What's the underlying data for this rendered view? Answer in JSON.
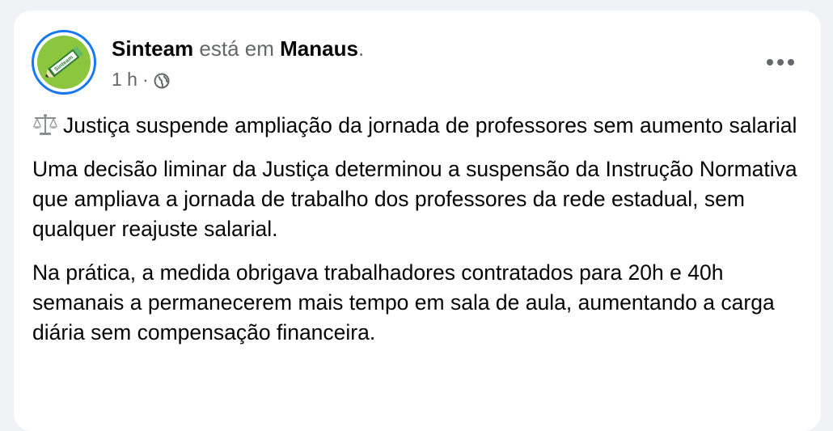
{
  "post": {
    "author": "Sinteam",
    "action": "está em",
    "place": "Manaus",
    "place_suffix": ".",
    "time": "1 h",
    "separator": "·",
    "privacy_icon": "globe-icon",
    "menu_icon": "more-horizontal-icon",
    "avatar_icon": "pencil-logo-icon",
    "avatar_logo_text": "Sinteam",
    "headline_emoji": "balance-scale-icon",
    "headline": "Justiça suspende ampliação da jornada de professores sem aumento salarial",
    "paragraphs": [
      "Uma decisão liminar da Justiça determinou a suspensão da Instrução Normativa que ampliava a jornada de trabalho dos professores da rede estadual, sem qualquer reajuste salarial.",
      "Na prática, a medida obrigava trabalhadores contratados para 20h e 40h semanais a permanecerem mais tempo em sala de aula, aumentando a carga diária sem compensação financeira."
    ]
  },
  "colors": {
    "page_background": "#f0f2f5",
    "card_background": "#ffffff",
    "primary_text": "#050505",
    "secondary_text": "#65676b",
    "avatar_ring": "#1877f2",
    "logo_green": "#8cc63f"
  }
}
